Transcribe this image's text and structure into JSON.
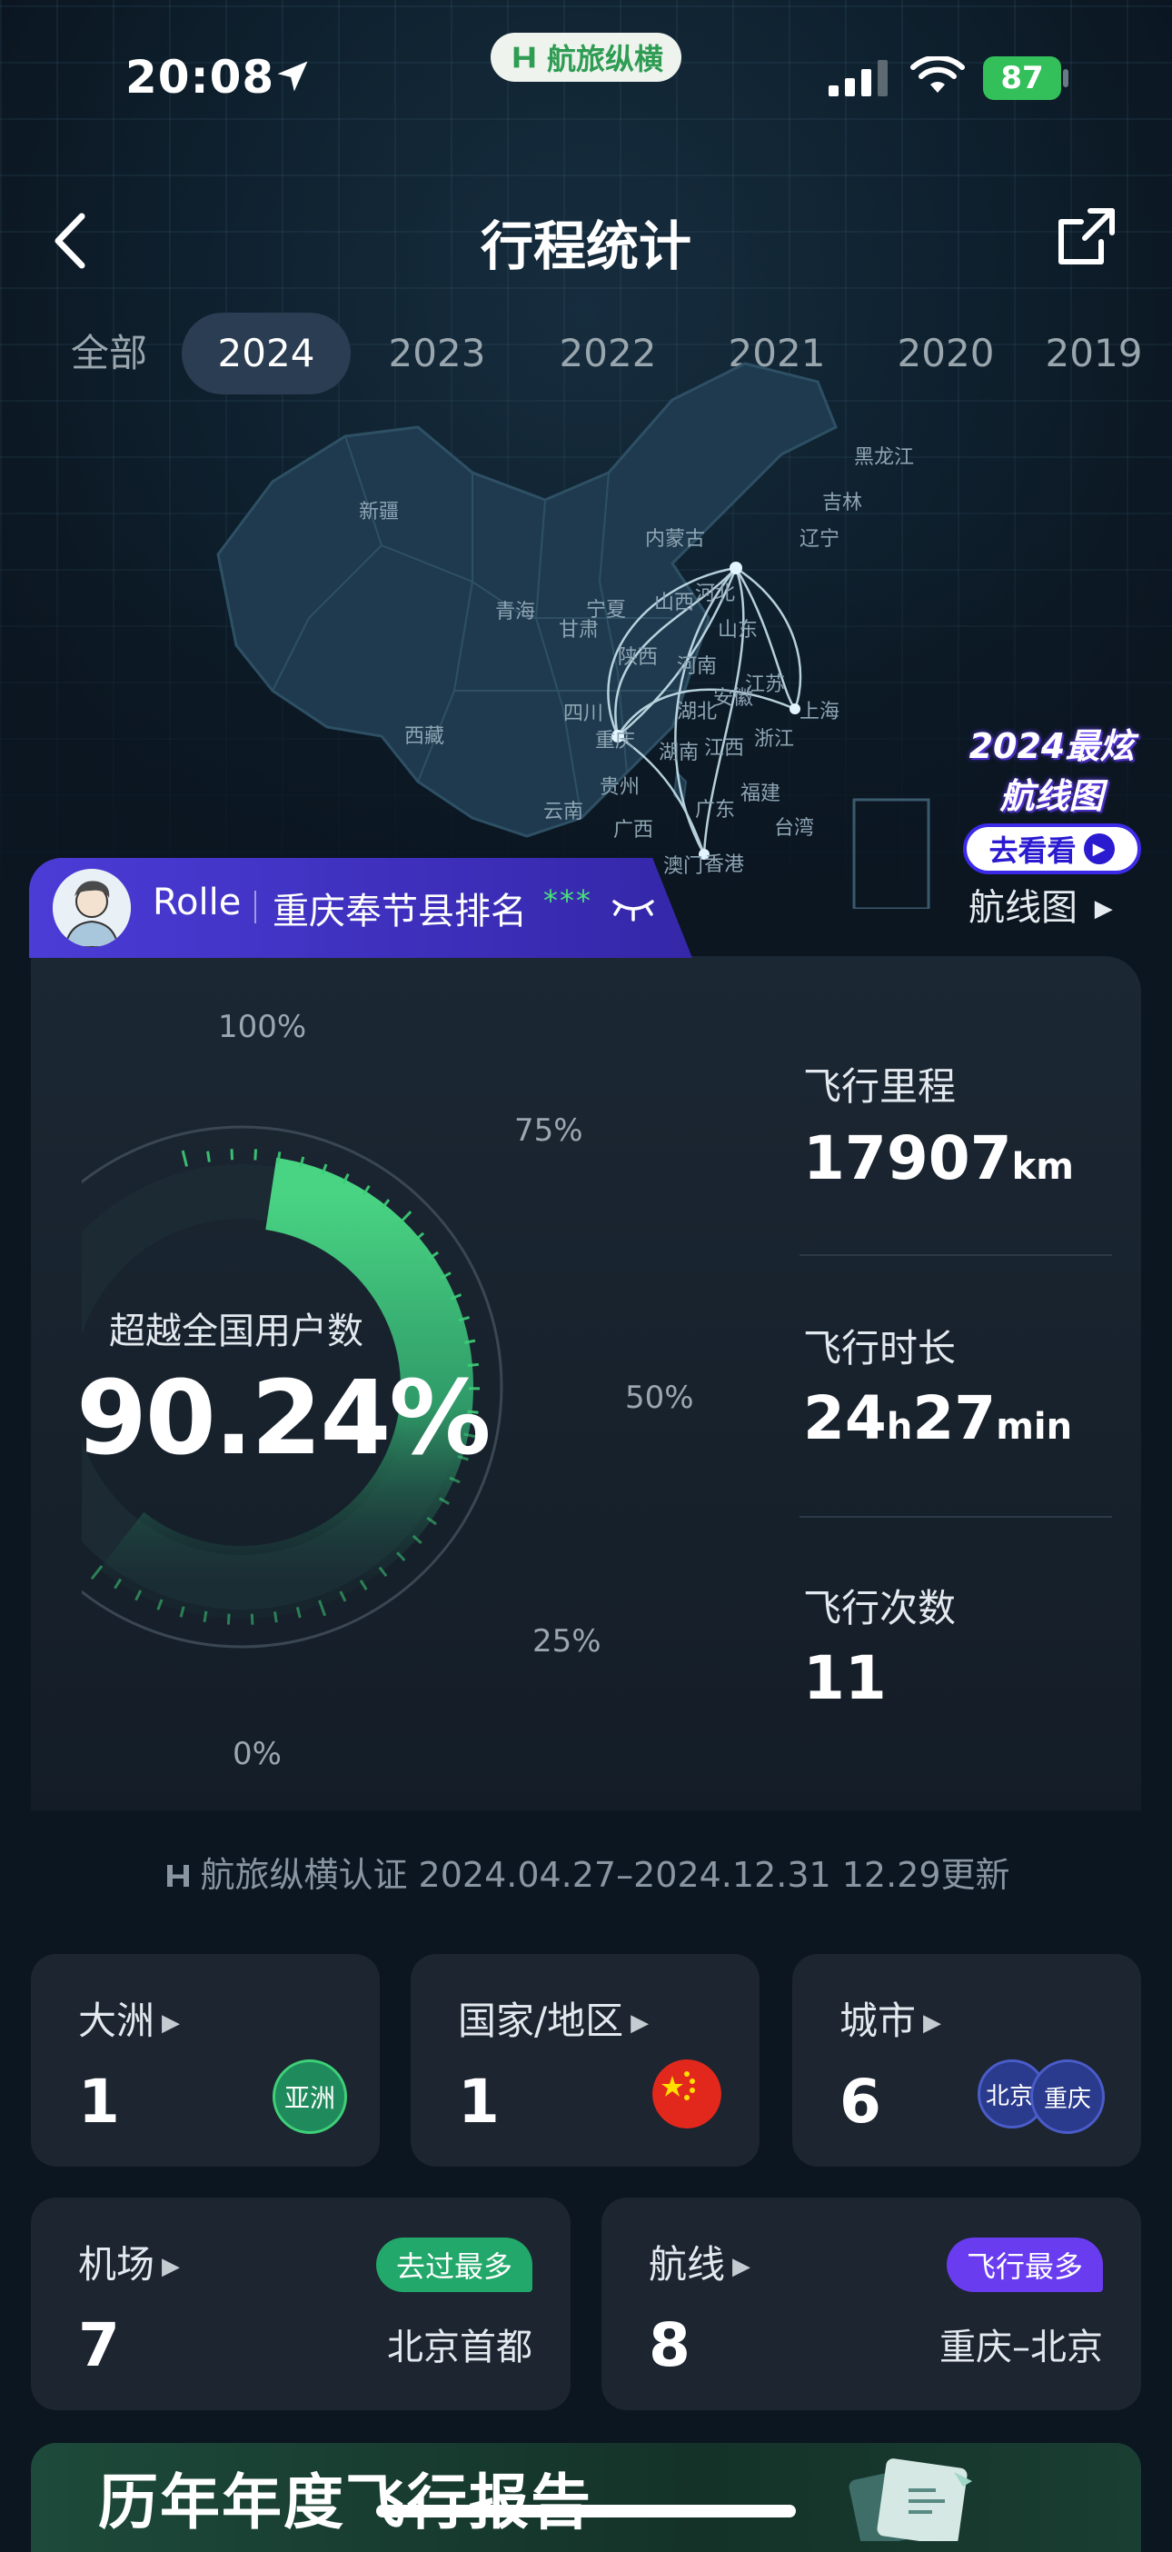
{
  "status_bar": {
    "time": "20:08",
    "battery": "87",
    "brand": "航旅纵横"
  },
  "header": {
    "title": "行程统计"
  },
  "year_tabs": [
    "全部",
    "2024",
    "2023",
    "2022",
    "2021",
    "2020",
    "2019"
  ],
  "active_year": "2024",
  "map": {
    "provinces": [
      "黑龙江",
      "吉林",
      "辽宁",
      "内蒙古",
      "新疆",
      "青海",
      "甘肃",
      "宁夏",
      "山西",
      "河北",
      "山东",
      "陕西",
      "河南",
      "江苏",
      "安徽",
      "上海",
      "四川",
      "湖北",
      "重庆",
      "西藏",
      "湖南",
      "江西",
      "浙江",
      "贵州",
      "福建",
      "云南",
      "广西",
      "广东",
      "台湾",
      "澳门",
      "香港"
    ],
    "promo_line1": "2024最炫",
    "promo_line2": "航线图",
    "promo_cta": "去看看",
    "route_map_link": "航线图"
  },
  "user": {
    "name": "Rolle",
    "rank_label": "重庆奉节县排名",
    "rank_masked": "***"
  },
  "beat": {
    "label": "超越全国用户数",
    "value": "90.24%",
    "percent": 90.24,
    "ticks": [
      "100%",
      "75%",
      "50%",
      "25%",
      "0%"
    ]
  },
  "metrics": {
    "distance": {
      "label": "飞行里程",
      "value": "17907",
      "unit": "km"
    },
    "duration": {
      "label": "飞行时长",
      "hours": "24",
      "h_unit": "h",
      "minutes": "27",
      "m_unit": "min"
    },
    "count": {
      "label": "飞行次数",
      "value": "11"
    }
  },
  "certification": "航旅纵横认证 2024.04.27–2024.12.31 12.29更新",
  "cards": {
    "continent": {
      "title": "大洲",
      "value": "1",
      "badge": "亚洲"
    },
    "country": {
      "title": "国家/地区",
      "value": "1"
    },
    "city": {
      "title": "城市",
      "value": "6",
      "badges": [
        "北京",
        "重庆"
      ]
    },
    "airport": {
      "title": "机场",
      "value": "7",
      "tag": "去过最多",
      "detail": "北京首都"
    },
    "route": {
      "title": "航线",
      "value": "8",
      "tag": "飞行最多",
      "detail": "重庆–北京"
    }
  },
  "banner": {
    "title": "历年年度飞行报告"
  },
  "colors": {
    "accent_green": "#3ecf78",
    "purple": "#4a3cd6",
    "tag_purple": "#6a3cf0",
    "tag_green": "#22a86a"
  }
}
